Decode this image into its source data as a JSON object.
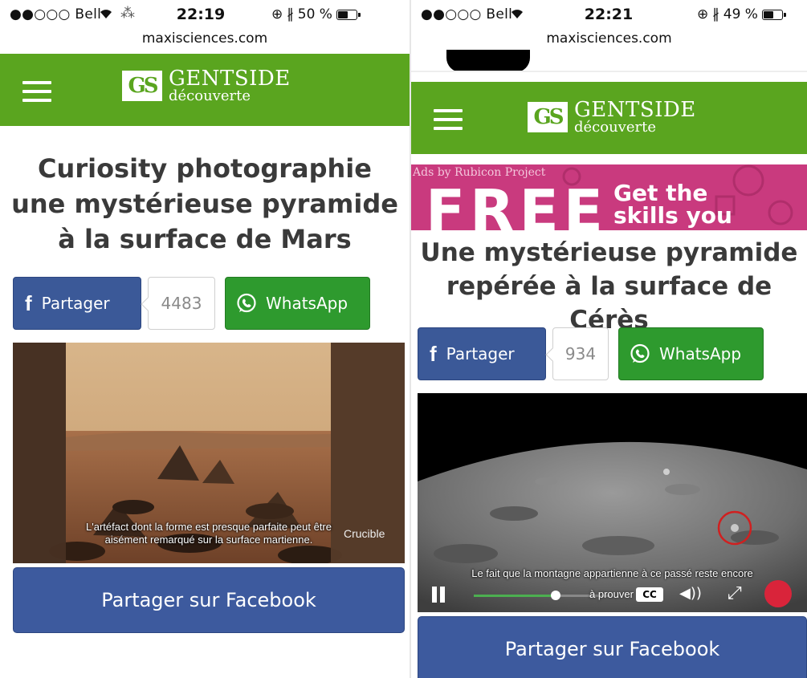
{
  "left": {
    "status": {
      "carrier": "●●○○○ Bell",
      "time": "22:19",
      "battery_text": "50 %",
      "battery_level": 0.5
    },
    "url": "maxisciences.com",
    "logo": {
      "mark": "GS",
      "name": "GENTSIDE",
      "sub": "découverte"
    },
    "title": "Curiosity photographie une mystérieuse pyramide à la surface de Mars",
    "share": {
      "fb_label": "Partager",
      "count": "4483",
      "whatsapp_label": "WhatsApp"
    },
    "video": {
      "subtitle_line1": "L'artéfact dont la forme est presque parfaite peut être",
      "subtitle_line2": "aisément remarqué sur la surface martienne.",
      "watermark": "Crucible"
    },
    "big_button": "Partager sur Facebook"
  },
  "right": {
    "status": {
      "carrier": "●●○○○ Bell",
      "time": "22:21",
      "battery_text": "49 %",
      "battery_level": 0.49
    },
    "url": "maxisciences.com",
    "logo": {
      "mark": "GS",
      "name": "GENTSIDE",
      "sub": "découverte"
    },
    "ad": {
      "tag": "Ads by Rubicon Project",
      "headline": "FREE",
      "text_line1": "Get the",
      "text_line2": "skills you"
    },
    "title": "Une mystérieuse pyramide repérée à la surface de Cérès",
    "share": {
      "fb_label": "Partager",
      "count": "934",
      "whatsapp_label": "WhatsApp"
    },
    "video": {
      "subtitle_line1": "Le fait que la montagne appartienne à ce passé reste encore",
      "subtitle_line2": "à prouver",
      "cc": "CC",
      "progress": 0.6
    },
    "big_button": "Partager sur Facebook"
  },
  "colors": {
    "header_green": "#5aa51f",
    "facebook_blue": "#3b5998",
    "whatsapp_green": "#2e9a2e",
    "ad_pink": "#c93a7e",
    "record_red": "#d9243a"
  },
  "icons": [
    "menu-icon",
    "wifi-icon",
    "bluetooth-icon",
    "lock-rotation-icon",
    "facebook-icon",
    "whatsapp-icon",
    "pause-icon",
    "volume-icon",
    "fullscreen-icon"
  ]
}
